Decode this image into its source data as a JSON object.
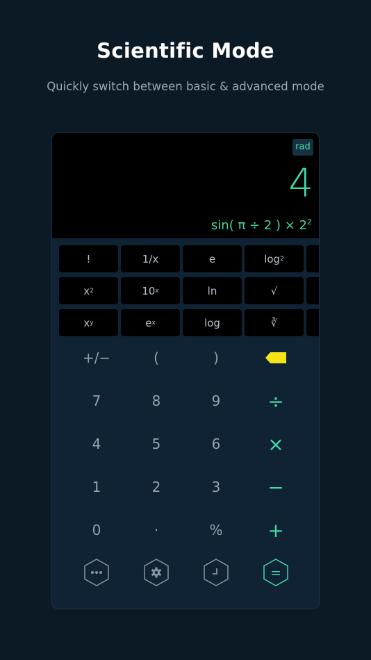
{
  "headline": "Scientific Mode",
  "subline": "Quickly switch between basic & advanced mode",
  "display": {
    "angle_mode": "rad",
    "result": "4",
    "expression": {
      "main": "sin( π ÷ 2 ) × 2",
      "power": "2"
    }
  },
  "sci_keys": {
    "r0": [
      "!",
      "1/x",
      "e",
      "log"
    ],
    "log2_sub": "2",
    "r1_x2_base": "x",
    "r1_x2_sup": "2",
    "r1_10x_base": "10",
    "r1_10x_sup": "x",
    "r1_ln": "ln",
    "r1_sqrt": "√",
    "r2_xy_base": "x",
    "r2_xy_sup": "y",
    "r2_ex_base": "e",
    "r2_ex_sup": "x",
    "r2_log": "log",
    "r2_cbrt": "∛"
  },
  "keypad": {
    "row0": [
      "+/−",
      "(",
      ")"
    ],
    "row1": [
      "7",
      "8",
      "9",
      "÷"
    ],
    "row2": [
      "4",
      "5",
      "6",
      "×"
    ],
    "row3": [
      "1",
      "2",
      "3",
      "−"
    ],
    "row4": [
      "0",
      "·",
      "%",
      "+"
    ]
  },
  "toolbar": {
    "equals": "="
  },
  "colors": {
    "accent": "#43d9a5",
    "backspace": "#f3e318",
    "background": "#0c1a26",
    "panel": "#0f2335"
  }
}
